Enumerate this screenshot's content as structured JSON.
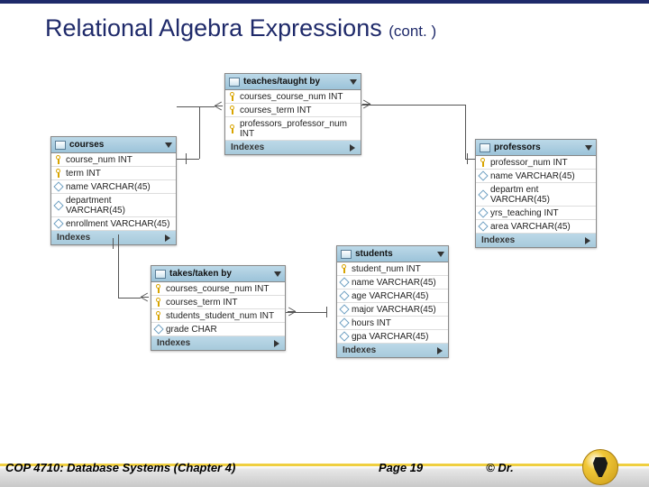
{
  "header": {
    "title": "Relational Algebra Expressions ",
    "cont": "(cont. )"
  },
  "labels": {
    "indexes": "Indexes"
  },
  "tables": [
    {
      "name": "teaches/taught by",
      "cols": [
        "courses_course_num INT",
        "courses_term INT",
        "professors_professor_num INT"
      ]
    },
    {
      "name": "courses",
      "cols": [
        "course_num INT",
        "term INT",
        "name VARCHAR(45)",
        "department VARCHAR(45)",
        "enrollment VARCHAR(45)"
      ]
    },
    {
      "name": "professors",
      "cols": [
        "professor_num INT",
        "name VARCHAR(45)",
        "departm ent VARCHAR(45)",
        "yrs_teaching INT",
        "area VARCHAR(45)"
      ]
    },
    {
      "name": "takes/taken by",
      "cols": [
        "courses_course_num INT",
        "courses_term INT",
        "students_student_num INT",
        "grade CHAR"
      ]
    },
    {
      "name": "students",
      "cols": [
        "student_num INT",
        "name VARCHAR(45)",
        "age VARCHAR(45)",
        "major VARCHAR(45)",
        "hours INT",
        "gpa VARCHAR(45)"
      ]
    }
  ],
  "footer": {
    "left": "COP 4710: Database Systems  (Chapter 4)",
    "page": "Page 19",
    "right": "© Dr."
  }
}
